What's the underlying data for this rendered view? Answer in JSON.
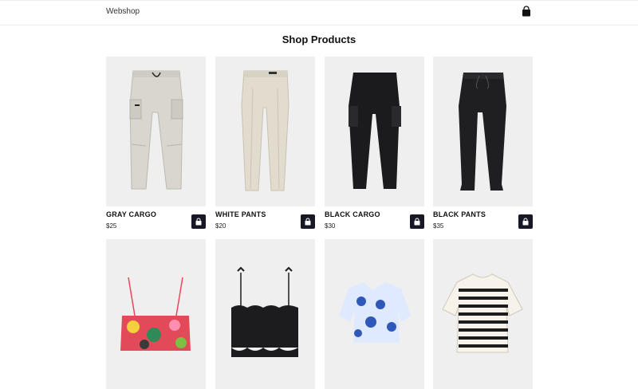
{
  "header": {
    "brand": "Webshop",
    "cart_icon": "shopping-bag-icon"
  },
  "main": {
    "title": "Shop Products"
  },
  "products": [
    {
      "name": "GRAY CARGO",
      "price": "$25",
      "image": "gray-cargo-pants",
      "color": "#d9d6cf"
    },
    {
      "name": "WHITE PANTS",
      "price": "$20",
      "image": "white-pants",
      "color": "#e2dccf"
    },
    {
      "name": "BLACK CARGO",
      "price": "$30",
      "image": "black-cargo-pants",
      "color": "#1b1b1d"
    },
    {
      "name": "BLACK PANTS",
      "price": "$35",
      "image": "black-pants",
      "color": "#1f1f21"
    },
    {
      "image": "floral-crop-top",
      "color": "#e24a5a"
    },
    {
      "image": "black-crop-top",
      "color": "#1c1c1e"
    },
    {
      "image": "blue-print-crop-top",
      "color": "#2f58b8"
    },
    {
      "image": "striped-tshirt",
      "color": "#1c1c1c"
    }
  ],
  "colors": {
    "accent": "#171725",
    "image_bg": "#efefef",
    "divider": "#ececec"
  }
}
